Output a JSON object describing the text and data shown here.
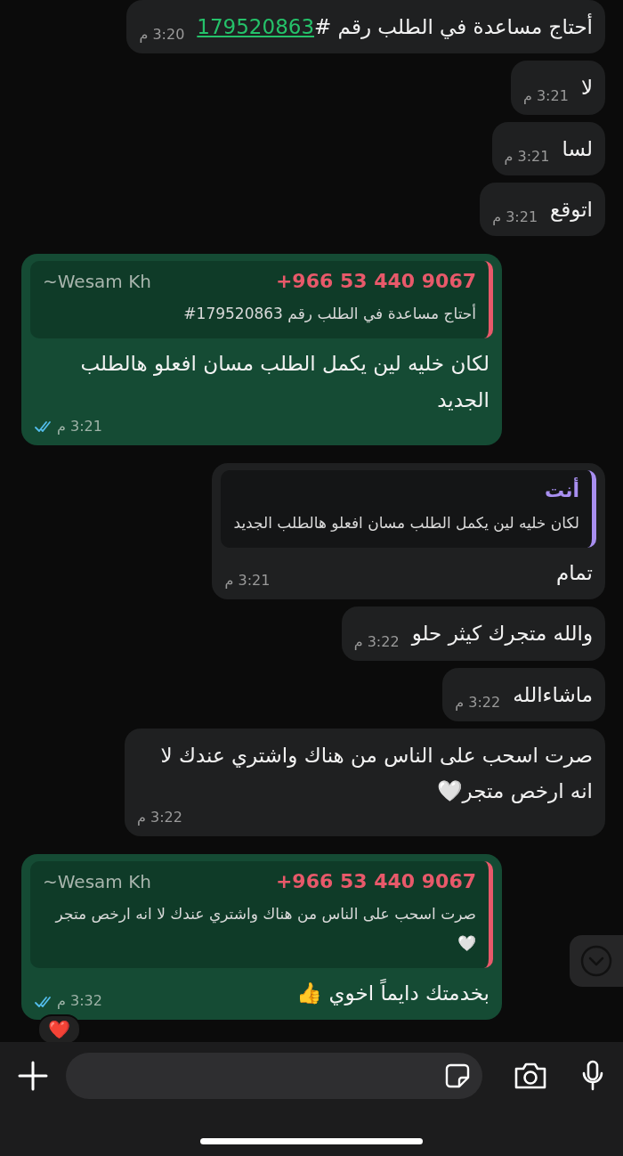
{
  "messages": [
    {
      "kind": "incoming",
      "text": "أحتاج مساعدة في الطلب رقم #",
      "link": "179520863",
      "time": "3:20 م"
    },
    {
      "kind": "incoming",
      "text": "لا",
      "time": "3:21 م"
    },
    {
      "kind": "incoming",
      "text": "لسا",
      "time": "3:21 م"
    },
    {
      "kind": "incoming",
      "text": "اتوقع",
      "time": "3:21 م"
    },
    {
      "kind": "outgoing",
      "quote": {
        "author": "+966 53 440 9067",
        "push_name": "~Wesam Kh",
        "color": "#e8596a",
        "text": "أحتاج مساعدة في الطلب رقم 179520863#"
      },
      "text": "لكان خليه لين يكمل الطلب مسان افعلو هالطلب الجديد",
      "time": "3:21 م",
      "read": true
    },
    {
      "kind": "incoming",
      "quote": {
        "author": "أنت",
        "color": "#a88ff0",
        "text": "لكان خليه لين يكمل الطلب مسان افعلو هالطلب الجديد"
      },
      "text": "تمام",
      "time": "3:21 م"
    },
    {
      "kind": "incoming",
      "text": "والله متجرك كيثر حلو",
      "time": "3:22 م"
    },
    {
      "kind": "incoming",
      "text": "ماشاءالله",
      "time": "3:22 م"
    },
    {
      "kind": "incoming",
      "text": "صرت اسحب على الناس من هناك واشتري عندك لا انه ارخص متجر🤍",
      "time": "3:22 م"
    },
    {
      "kind": "outgoing",
      "quote": {
        "author": "+966 53 440 9067",
        "push_name": "~Wesam Kh",
        "color": "#e8596a",
        "text": "صرت اسحب على الناس من هناك واشتري عندك لا انه ارخص متجر🤍"
      },
      "text": "بخدمتك دايماً اخوي 👍",
      "time": "3:32 م",
      "read": true,
      "reaction": "❤️"
    }
  ]
}
